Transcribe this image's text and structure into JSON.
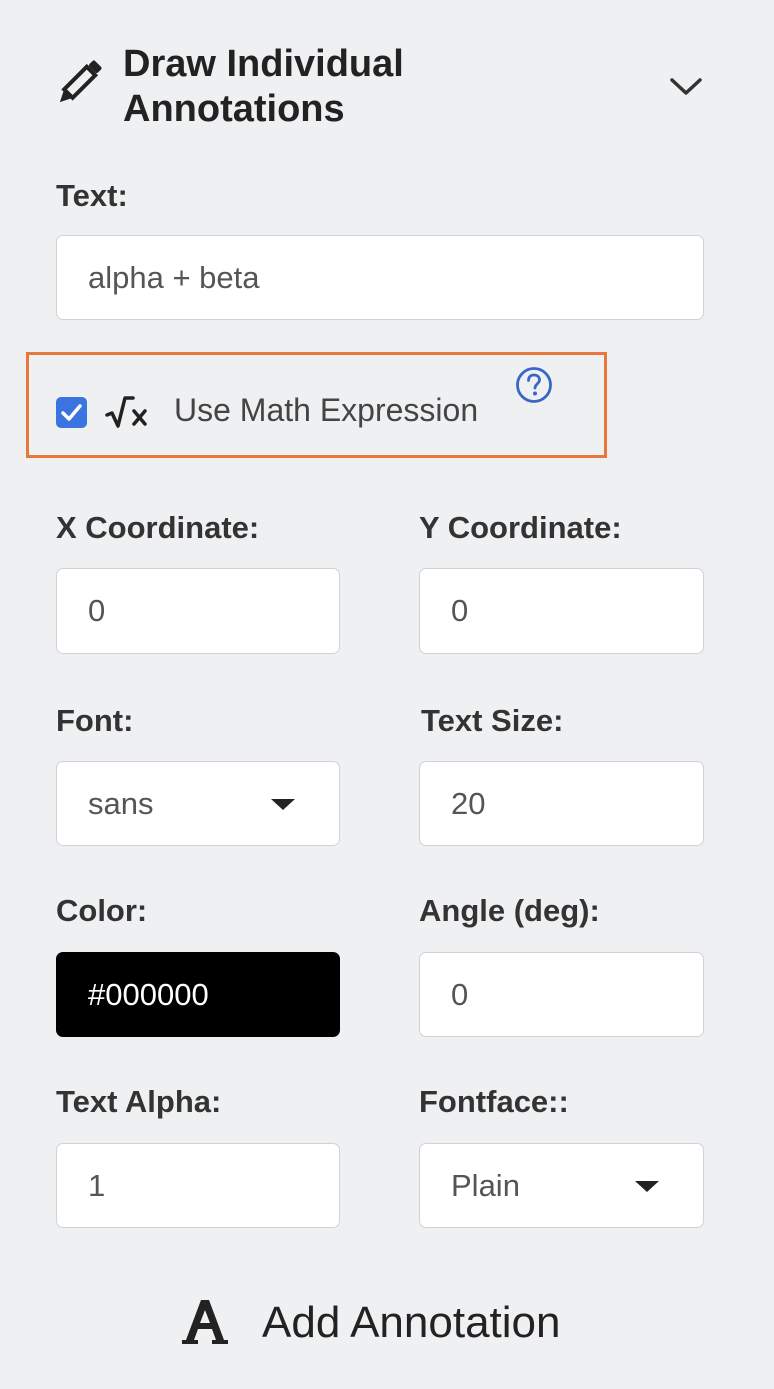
{
  "header": {
    "title": "Draw Individual\nAnnotations",
    "icon": "pencil-icon",
    "toggle_icon": "chevron-down-icon"
  },
  "text_field": {
    "label": "Text:",
    "value": "alpha + beta"
  },
  "math_expression": {
    "checked": true,
    "label": "Use Math Expression",
    "icon": "square-root-icon",
    "help_icon": "question-circle-icon",
    "highlight_color": "#e8773a",
    "checkbox_color": "#3b74e0"
  },
  "x_coordinate": {
    "label": "X Coordinate:",
    "value": "0"
  },
  "y_coordinate": {
    "label": "Y Coordinate:",
    "value": "0"
  },
  "font": {
    "label": "Font:",
    "selected": "sans"
  },
  "text_size": {
    "label": "Text Size:",
    "value": "20"
  },
  "color": {
    "label": "Color:",
    "value": "#000000",
    "swatch": "#000000"
  },
  "angle": {
    "label": "Angle (deg):",
    "value": "0"
  },
  "text_alpha": {
    "label": "Text Alpha:",
    "value": "1"
  },
  "fontface": {
    "label": "Fontface::",
    "selected": "Plain"
  },
  "add_button": {
    "label": "Add Annotation",
    "icon": "font-letter-a-icon"
  }
}
